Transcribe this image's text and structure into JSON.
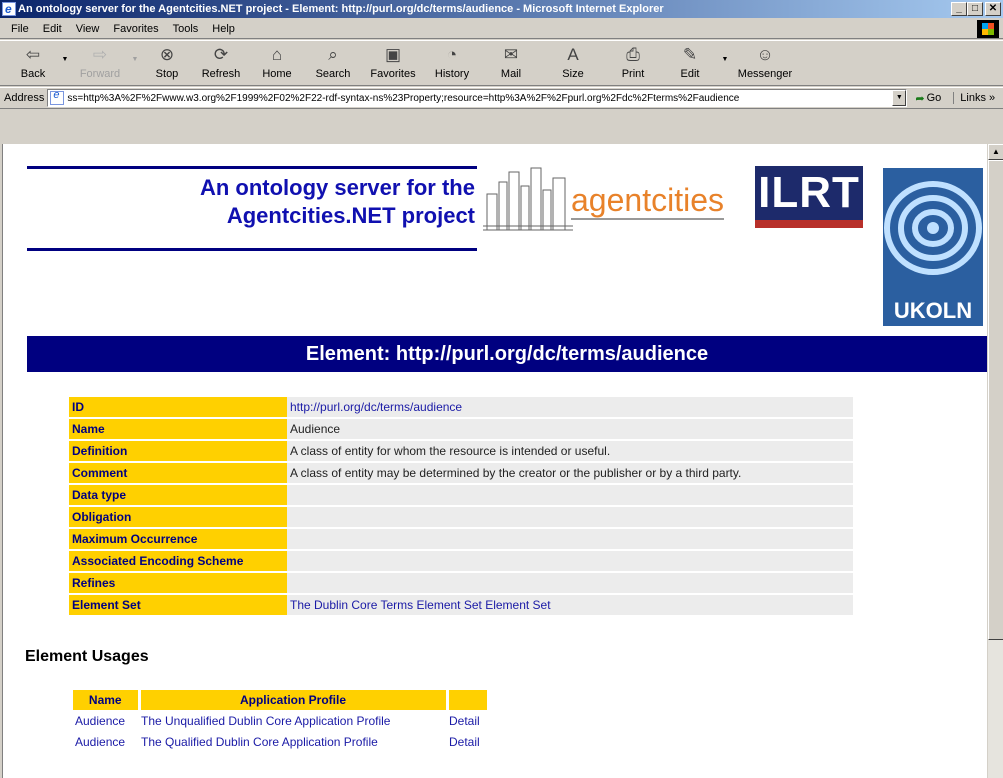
{
  "window": {
    "title": "An ontology server for the Agentcities.NET project - Element: http://purl.org/dc/terms/audience - Microsoft Internet Explorer",
    "minimize": "_",
    "maximize": "□",
    "close": "✕"
  },
  "menu": [
    {
      "label": "File"
    },
    {
      "label": "Edit"
    },
    {
      "label": "View"
    },
    {
      "label": "Favorites"
    },
    {
      "label": "Tools"
    },
    {
      "label": "Help"
    }
  ],
  "toolbar": {
    "back": "Back",
    "forward": "Forward",
    "stop": "Stop",
    "refresh": "Refresh",
    "home": "Home",
    "search": "Search",
    "favorites": "Favorites",
    "history": "History",
    "mail": "Mail",
    "size": "Size",
    "print": "Print",
    "edit": "Edit",
    "messenger": "Messenger"
  },
  "address": {
    "label": "Address",
    "value": "ss=http%3A%2F%2Fwww.w3.org%2F1999%2F02%2F22-rdf-syntax-ns%23Property;resource=http%3A%2F%2Fpurl.org%2Fdc%2Fterms%2Faudience",
    "go": "Go",
    "links": "Links »"
  },
  "page": {
    "site_title_line1": "An ontology server for the",
    "site_title_line2": "Agentcities.NET project",
    "logo_agentcities": "agentcities",
    "logo_ilrt": "ILRT",
    "logo_ukoln": "UKOLN",
    "banner": "Element: http://purl.org/dc/terms/audience",
    "properties": [
      {
        "key": "ID",
        "value": "http://purl.org/dc/terms/audience",
        "link": true
      },
      {
        "key": "Name",
        "value": "Audience",
        "link": false
      },
      {
        "key": "Definition",
        "value": "A class of entity for whom the resource is intended or useful.",
        "link": false
      },
      {
        "key": "Comment",
        "value": "A class of entity may be determined by the creator or the publisher or by a third party.",
        "link": false
      },
      {
        "key": "Data type",
        "value": "",
        "link": false
      },
      {
        "key": "Obligation",
        "value": "",
        "link": false
      },
      {
        "key": "Maximum Occurrence",
        "value": "",
        "link": false
      },
      {
        "key": "Associated Encoding Scheme",
        "value": "",
        "link": false
      },
      {
        "key": "Refines",
        "value": "",
        "link": false
      },
      {
        "key": "Element Set",
        "value": "The Dublin Core Terms Element Set Element Set",
        "link": true
      }
    ],
    "usages_title": "Element Usages",
    "usage_headers": {
      "name": "Name",
      "profile": "Application Profile",
      "detail": ""
    },
    "usages": [
      {
        "name": "Audience",
        "profile": "The Unqualified Dublin Core Application Profile",
        "detail": "Detail"
      },
      {
        "name": "Audience",
        "profile": "The Qualified Dublin Core Application Profile",
        "detail": "Detail"
      }
    ]
  },
  "colors": {
    "navy": "#000080",
    "gold": "#ffd000",
    "link": "#1a1aa6"
  }
}
